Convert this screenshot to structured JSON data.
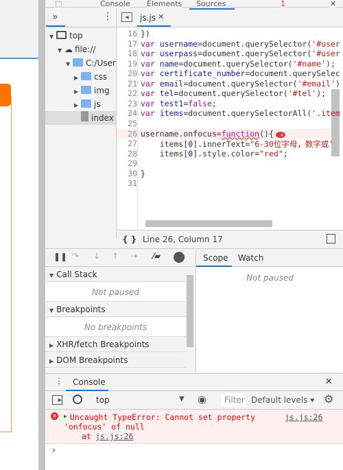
{
  "devtools": {
    "top_tabs": [
      "Console",
      "Elements",
      "Sources"
    ],
    "error_count": "1",
    "navigator": {
      "more_label": "»",
      "tree": [
        {
          "label": "top",
          "type": "frame",
          "depth": 0,
          "expanded": true
        },
        {
          "label": "file://",
          "type": "cloud",
          "depth": 1,
          "expanded": true
        },
        {
          "label": "C:/User",
          "type": "folder",
          "depth": 2,
          "expanded": true
        },
        {
          "label": "css",
          "type": "folder",
          "depth": 3,
          "expanded": false
        },
        {
          "label": "img",
          "type": "folder",
          "depth": 3,
          "expanded": false
        },
        {
          "label": "js",
          "type": "folder",
          "depth": 3,
          "expanded": false
        },
        {
          "label": "index",
          "type": "file",
          "depth": 3,
          "selected": true
        }
      ]
    },
    "editor": {
      "tab": "js.js",
      "lines": [
        {
          "n": "16",
          "seg": [
            [
              "})",
              "pn"
            ]
          ]
        },
        {
          "n": "17",
          "seg": [
            [
              "var ",
              "kw"
            ],
            [
              "username",
              "vr"
            ],
            [
              "=document.querySelector(",
              "pn"
            ],
            [
              "'#user",
              "st"
            ]
          ]
        },
        {
          "n": "18",
          "seg": [
            [
              "var ",
              "kw"
            ],
            [
              "userpass",
              "vr"
            ],
            [
              "=document.querySelector(",
              "pn"
            ],
            [
              "'#user",
              "st"
            ]
          ]
        },
        {
          "n": "19",
          "seg": [
            [
              "var ",
              "kw"
            ],
            [
              "name",
              "vr"
            ],
            [
              "=document.querySelector(",
              "pn"
            ],
            [
              "'#name'",
              "st"
            ],
            [
              ");",
              "pn"
            ]
          ]
        },
        {
          "n": "20",
          "seg": [
            [
              "var ",
              "kw"
            ],
            [
              "certificate_number",
              "vr"
            ],
            [
              "=document.querySelec",
              "pn"
            ]
          ]
        },
        {
          "n": "21",
          "seg": [
            [
              "var ",
              "kw"
            ],
            [
              "email",
              "vr"
            ],
            [
              "=document.querySelector(",
              "pn"
            ],
            [
              "'#email'",
              "st"
            ],
            [
              ")",
              "pn"
            ]
          ]
        },
        {
          "n": "22",
          "seg": [
            [
              "var ",
              "kw"
            ],
            [
              "tel",
              "vr"
            ],
            [
              "=document.querySelector(",
              "pn"
            ],
            [
              "'#tel'",
              "st"
            ],
            [
              ");",
              "pn"
            ]
          ]
        },
        {
          "n": "23",
          "seg": [
            [
              "var ",
              "kw"
            ],
            [
              "test1",
              "vr"
            ],
            [
              "=",
              "pn"
            ],
            [
              "false",
              "kw"
            ],
            [
              ";",
              "pn"
            ]
          ]
        },
        {
          "n": "24",
          "seg": [
            [
              "var ",
              "kw"
            ],
            [
              "items",
              "vr"
            ],
            [
              "=document.querySelectorAll(",
              "pn"
            ],
            [
              "'.item",
              "st"
            ]
          ]
        },
        {
          "n": "25",
          "seg": []
        },
        {
          "n": "26",
          "seg": [
            [
              "username.onfocus=",
              "pn"
            ],
            [
              "function",
              "kw"
            ],
            [
              "(){",
              "pn"
            ]
          ],
          "error": true
        },
        {
          "n": "27",
          "seg": [
            [
              "    items[",
              "pn"
            ],
            [
              "0",
              "nm"
            ],
            [
              "].innerText=",
              "pn"
            ],
            [
              "\"6-30位字母，数字或'",
              "st"
            ]
          ]
        },
        {
          "n": "28",
          "seg": [
            [
              "    items[",
              "pn"
            ],
            [
              "0",
              "nm"
            ],
            [
              "].style.color=",
              "pn"
            ],
            [
              "\"red\"",
              "st"
            ],
            [
              ";",
              "pn"
            ]
          ]
        },
        {
          "n": "29",
          "seg": []
        },
        {
          "n": "30",
          "seg": [
            [
              "}",
              "pn"
            ]
          ]
        },
        {
          "n": "31",
          "seg": []
        }
      ],
      "status": "Line 26, Column 17",
      "pretty_print": "{ }"
    },
    "debugger": {
      "sections": [
        {
          "label": "Call Stack",
          "expanded": true,
          "body": "Not paused"
        },
        {
          "label": "Breakpoints",
          "expanded": true,
          "body": "No breakpoints"
        },
        {
          "label": "XHR/fetch Breakpoints",
          "expanded": false
        },
        {
          "label": "DOM Breakpoints",
          "expanded": false
        }
      ],
      "tabs": [
        "Scope",
        "Watch"
      ],
      "scope_body": "Not paused"
    },
    "console": {
      "tab": "Console",
      "context": "top",
      "filter_placeholder": "Filter",
      "levels": "Default levels ▾",
      "error": {
        "line1": "Uncaught TypeError: Cannot set property",
        "line2": "'onfocus' of null",
        "at": "at ",
        "at_link": "js.js:26",
        "source": "js.js:26"
      },
      "prompt": "›"
    },
    "colors": {
      "accent": "#1a73e8",
      "error": "#ff0000",
      "keyword": "#aa0d91",
      "string": "#c41a16",
      "page_orange": "#ff7300"
    }
  }
}
